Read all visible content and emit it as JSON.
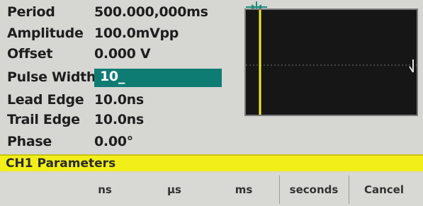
{
  "params": [
    {
      "label": "Period",
      "value": "500.000,000ms"
    },
    {
      "label": "Amplitude",
      "value": "100.0mVpp"
    },
    {
      "label": "Offset",
      "value": "0.000 V"
    },
    {
      "label": "Pulse Width",
      "value": "10_"
    },
    {
      "label": "Lead Edge",
      "value": "10.0ns"
    },
    {
      "label": "Trail Edge",
      "value": "10.0ns"
    },
    {
      "label": "Phase",
      "value": "0.00°"
    }
  ],
  "status": {
    "text": "CH1  Parameters"
  },
  "softkeys": [
    {
      "label": ""
    },
    {
      "label": "ns"
    },
    {
      "label": "µs"
    },
    {
      "label": "ms"
    },
    {
      "label": "seconds"
    },
    {
      "label": "Cancel"
    }
  ],
  "colors": {
    "edit_highlight": "#0f7c74",
    "status_bar": "#f2ee1a",
    "waveform": "#f2ee1a",
    "scope_bg": "#161616"
  }
}
